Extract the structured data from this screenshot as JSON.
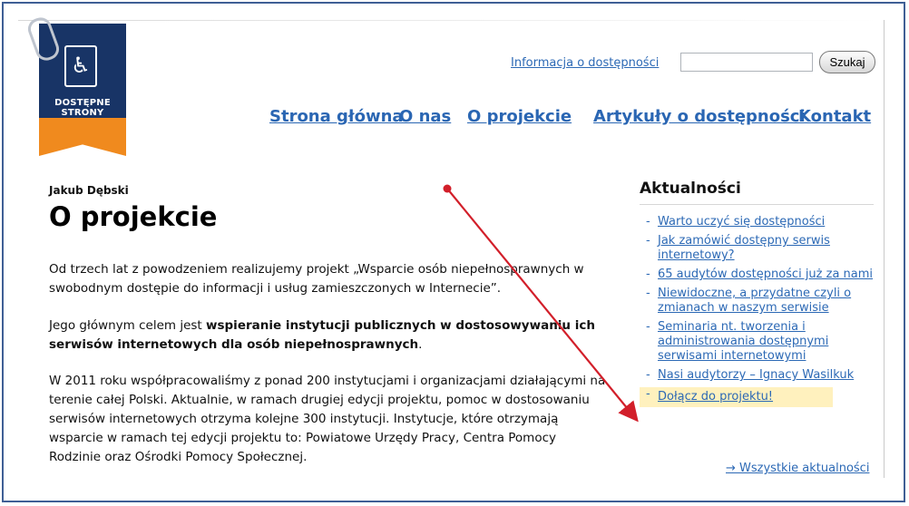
{
  "logo": {
    "line1": "DOSTĘPNE",
    "line2": "STRONY",
    "icon": "document-accessibility-icon"
  },
  "header": {
    "accessibility_link": "Informacja o dostępności",
    "search": {
      "placeholder": "",
      "button_label": "Szukaj"
    },
    "nav": [
      "Strona główna",
      "O nas",
      "O projekcie",
      "Artykuły o dostępności",
      "Kontakt"
    ]
  },
  "article": {
    "author": "Jakub Dębski",
    "title": "O projekcie",
    "p1": "Od trzech lat z powodzeniem realizujemy projekt „Wsparcie osób niepełnosprawnych w swobodnym dostępie do informacji i usług zamieszczonych w Internecie”.",
    "p2_prefix": "Jego głównym celem jest ",
    "p2_bold": "wspieranie instytucji publicznych w dostosowywaniu ich serwisów internetowych dla osób niepełnosprawnych",
    "p2_suffix": ".",
    "p3": "W 2011 roku współpracowaliśmy z ponad 200 instytucjami i organizacjami działającymi na terenie całej Polski. Aktualnie, w ramach drugiej edycji projektu, pomoc w dostosowaniu serwisów internetowych otrzyma kolejne 300 instytucji. Instytucje, które otrzymają wsparcie w ramach tej edycji projektu to: Powiatowe Urzędy Pracy, Centra Pomocy Rodzinie oraz Ośrodki Pomocy Społecznej."
  },
  "sidebar": {
    "title": "Aktualności",
    "items": [
      "Warto uczyć się dostępności",
      "Jak zamówić dostępny serwis internetowy?",
      "65 audytów dostępności już za nami",
      "Niewidoczne, a przydatne czyli o zmianach w naszym serwisie",
      "Seminaria nt. tworzenia i administrowania dostępnymi serwisami internetowymi",
      "Nasi audytorzy – Ignacy Wasilkuk",
      "Dołącz do projektu!"
    ],
    "all_news": "→ Wszystkie aktualności"
  },
  "colors": {
    "link": "#2c69b5",
    "logo_blue": "#183466",
    "logo_orange": "#f08a1e",
    "highlight": "#fff1be",
    "arrow": "#d21f2a"
  }
}
